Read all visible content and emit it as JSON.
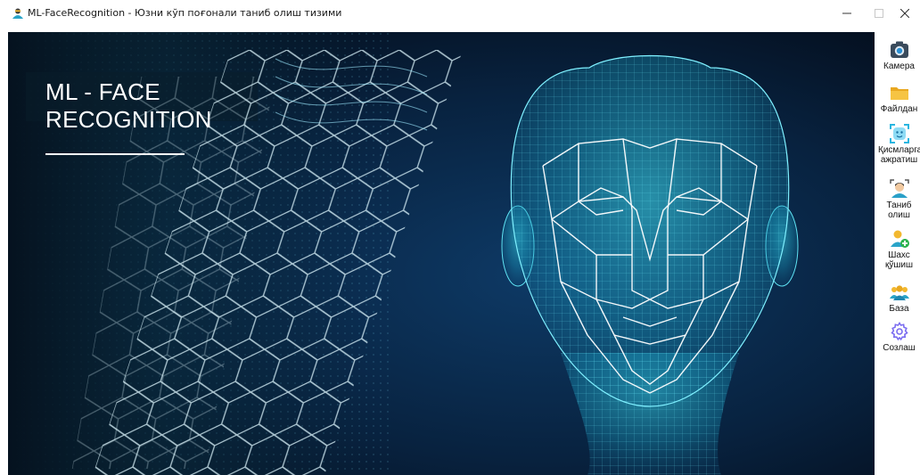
{
  "window": {
    "title": "ML-FaceRecognition - Юзни кўп поғонали таниб олиш тизими",
    "minimize_glyph": "—",
    "maximize_glyph": "☐",
    "close_glyph": "✕"
  },
  "hero": {
    "title_line1": "ML - FACE",
    "title_line2": "RECOGNITION"
  },
  "toolbar": {
    "items": [
      {
        "label": "Камера",
        "icon": "camera-icon"
      },
      {
        "label": "Файлдан",
        "icon": "folder-icon"
      },
      {
        "label": "Қисмларга\nажратиш",
        "icon": "face-scan-icon"
      },
      {
        "label": "Таниб\nолиш",
        "icon": "face-recognize-icon"
      },
      {
        "label": "Шахс\nқўшиш",
        "icon": "add-person-icon"
      },
      {
        "label": "База",
        "icon": "people-database-icon"
      },
      {
        "label": "Созлаш",
        "icon": "gear-icon"
      }
    ]
  },
  "colors": {
    "background_dark": "#04101f",
    "accent_cyan": "#29d3e6",
    "folder_yellow": "#f2b82f",
    "gear_purple": "#7a6cf0"
  }
}
